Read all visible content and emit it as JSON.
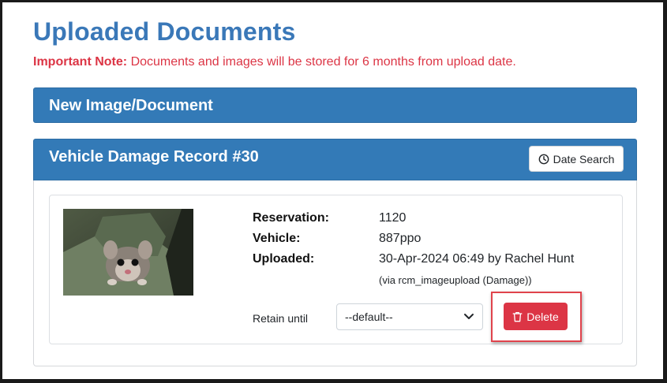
{
  "page": {
    "title": "Uploaded Documents",
    "note_label": "Important Note:",
    "note_text": "Documents and images will be stored for 6 months from upload date."
  },
  "new_panel": {
    "title": "New Image/Document"
  },
  "record": {
    "title": "Vehicle Damage Record #30",
    "date_search_label": "Date Search",
    "details": {
      "reservation_label": "Reservation:",
      "reservation_value": "1120",
      "vehicle_label": "Vehicle:",
      "vehicle_value": "887ppo",
      "uploaded_label": "Uploaded:",
      "uploaded_value": "30-Apr-2024 06:49 by Rachel Hunt",
      "via_text": "(via rcm_imageupload (Damage))"
    },
    "retain_label": "Retain until",
    "retain_selected": "--default--",
    "delete_label": "Delete",
    "thumbnail_icon": "possum-photo"
  },
  "colors": {
    "title": "#3a78b8",
    "note": "#dc3545",
    "panel_header": "#337ab7",
    "delete": "#dc3545",
    "highlight": "#e0434c"
  }
}
